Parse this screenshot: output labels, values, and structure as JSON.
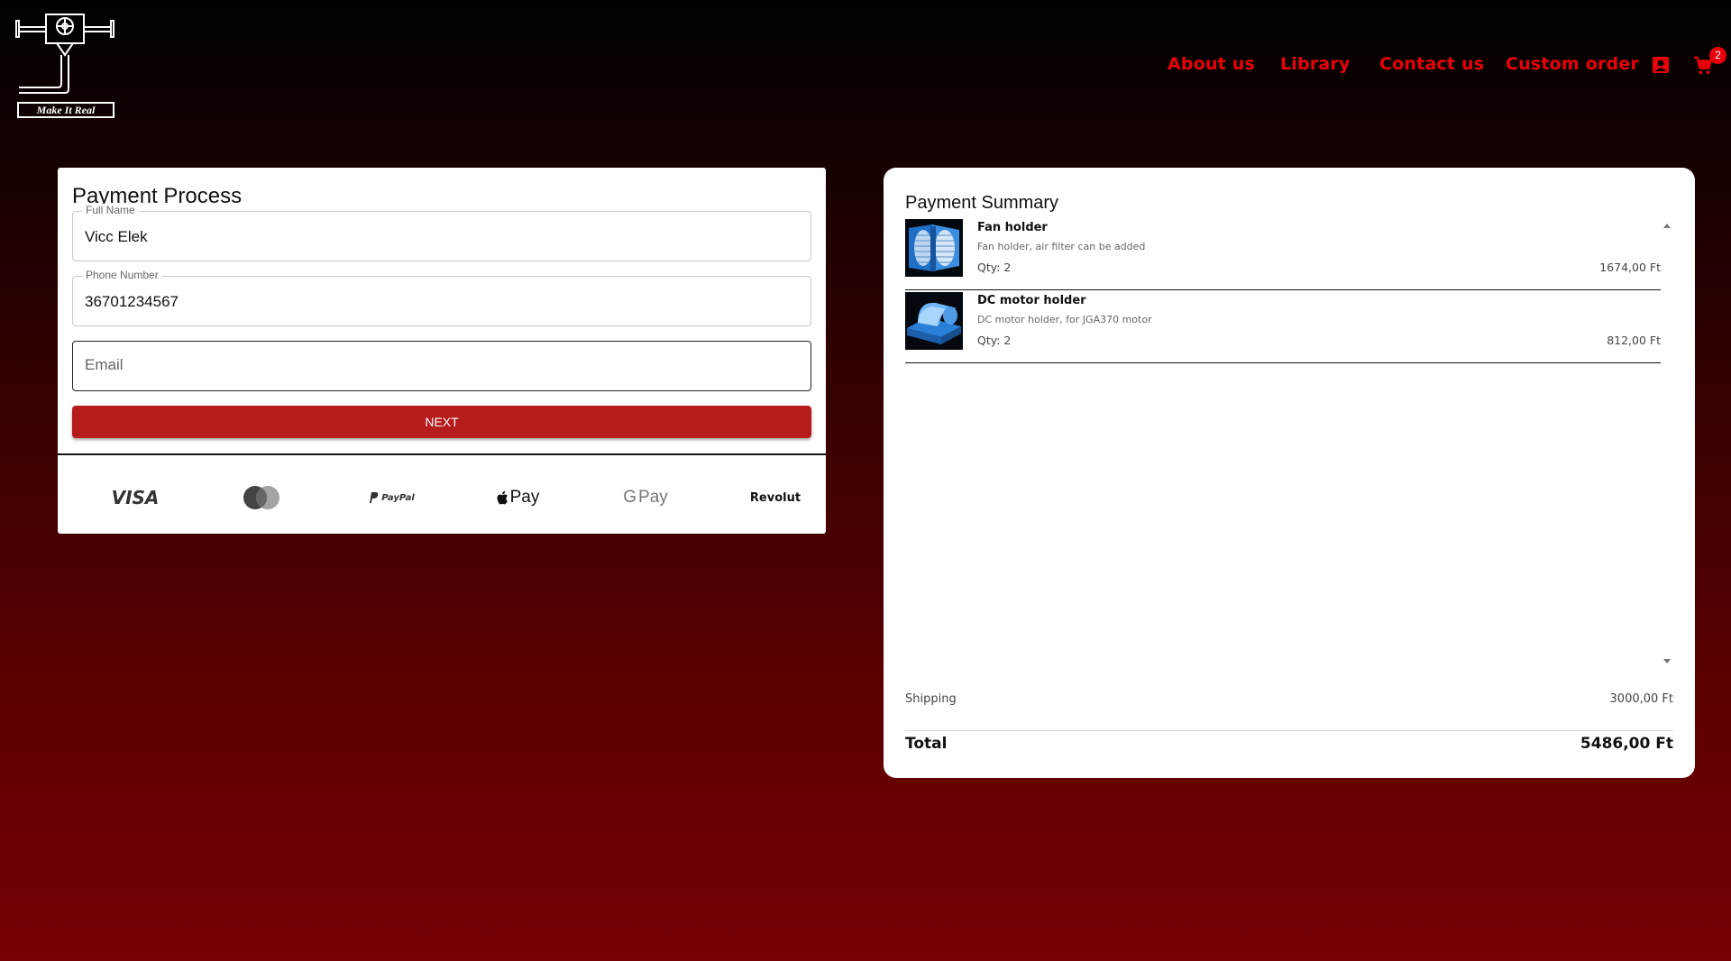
{
  "brand": {
    "logo_text": "Make It Real"
  },
  "nav": {
    "links": [
      "About us",
      "Library",
      "Contact us",
      "Custom order"
    ],
    "cart_count": "2",
    "icons": [
      "account-icon",
      "cart-icon"
    ]
  },
  "payment_process": {
    "title": "Payment Process",
    "fields": {
      "full_name": {
        "label": "Full Name",
        "value": "Vicc Elek"
      },
      "phone": {
        "label": "Phone Number",
        "value": "36701234567"
      },
      "email": {
        "placeholder": "Email",
        "value": ""
      }
    },
    "next_label": "NEXT",
    "payment_methods": [
      "VISA",
      "mastercard-icon",
      "PayPal",
      "Pay",
      "Pay",
      "Revolut"
    ]
  },
  "payment_summary": {
    "title": "Payment Summary",
    "items": [
      {
        "name": "Fan holder",
        "desc": "Fan holder, air filter can be added",
        "qty": "Qty: 2",
        "price": "1674,00 Ft"
      },
      {
        "name": "DC motor holder",
        "desc": "DC motor holder, for JGA370 motor",
        "qty": "Qty: 2",
        "price": "812,00 Ft"
      }
    ],
    "shipping_label": "Shipping",
    "shipping_value": "3000,00 Ft",
    "total_label": "Total",
    "total_value": "5486,00 Ft"
  },
  "colors": {
    "accent": "#e8000a",
    "button": "#b71c1c",
    "card": "#ffffff"
  }
}
